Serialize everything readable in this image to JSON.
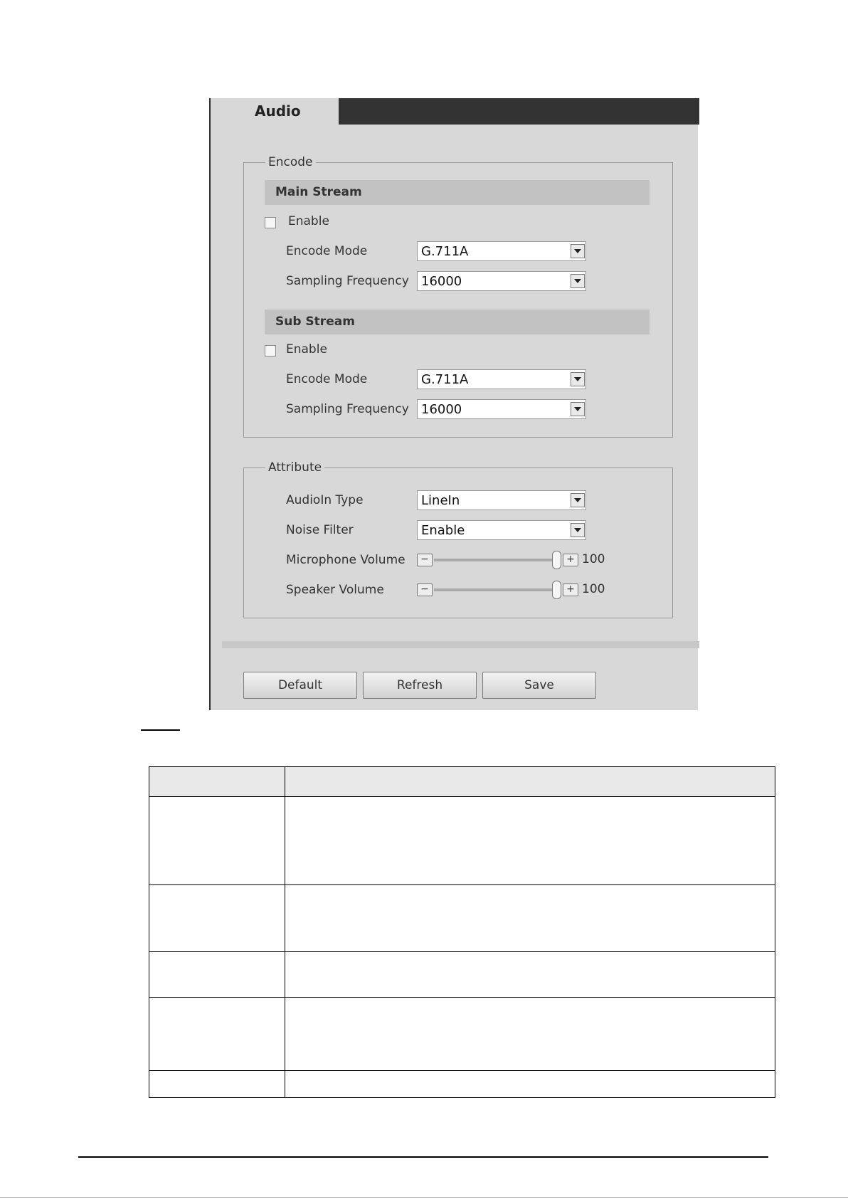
{
  "tab": {
    "label": "Audio"
  },
  "encode": {
    "legend": "Encode",
    "main_stream": {
      "title": "Main Stream",
      "enable_label": "Enable",
      "enabled": false,
      "encode_mode_label": "Encode Mode",
      "encode_mode_value": "G.711A",
      "sampling_label": "Sampling Frequency",
      "sampling_value": "16000"
    },
    "sub_stream": {
      "title": "Sub Stream",
      "enable_label": "Enable",
      "enabled": false,
      "encode_mode_label": "Encode Mode",
      "encode_mode_value": "G.711A",
      "sampling_label": "Sampling Frequency",
      "sampling_value": "16000"
    }
  },
  "attribute": {
    "legend": "Attribute",
    "audioin_type_label": "AudioIn Type",
    "audioin_type_value": "LineIn",
    "noise_filter_label": "Noise Filter",
    "noise_filter_value": "Enable",
    "mic_volume_label": "Microphone Volume",
    "mic_volume_value": "100",
    "speaker_volume_label": "Speaker Volume",
    "speaker_volume_value": "100",
    "minus_symbol": "−",
    "plus_symbol": "+"
  },
  "buttons": {
    "default": "Default",
    "refresh": "Refresh",
    "save": "Save"
  }
}
